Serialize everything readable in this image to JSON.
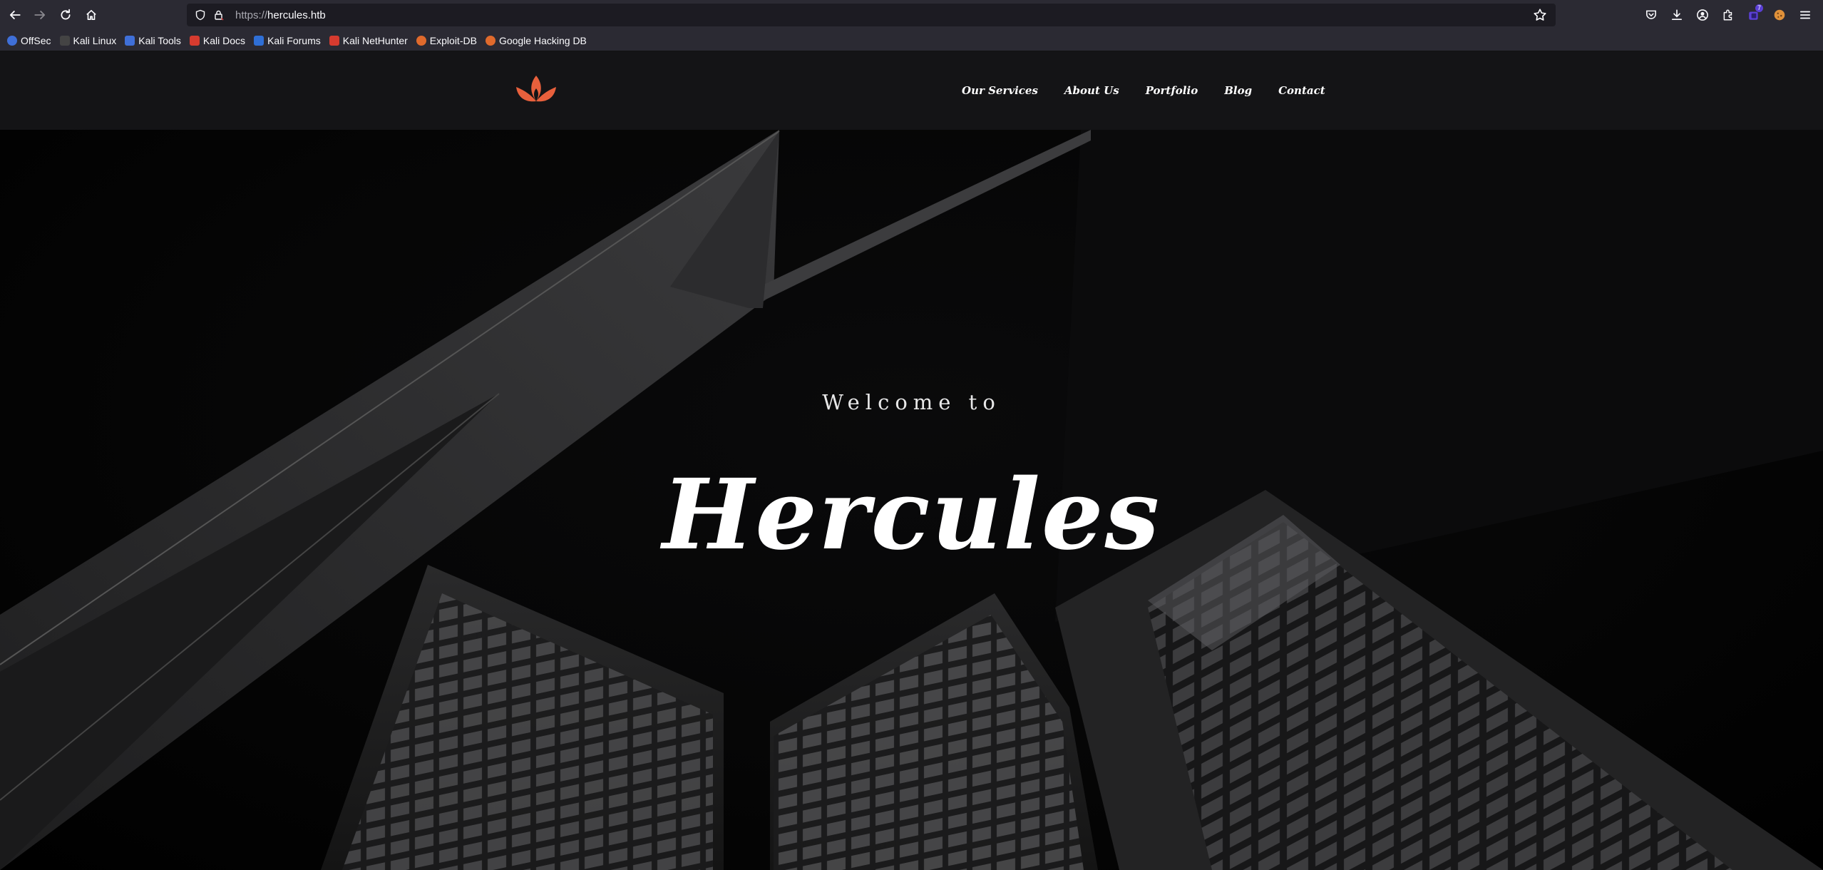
{
  "browser": {
    "url_scheme": "https://",
    "url_host": "hercules.htb",
    "extension_badge": "7"
  },
  "bookmarks": [
    {
      "label": "OffSec",
      "color": "#3f6fd8"
    },
    {
      "label": "Kali Linux",
      "color": "#2a2a2a"
    },
    {
      "label": "Kali Tools",
      "color": "#3f6fd8"
    },
    {
      "label": "Kali Docs",
      "color": "#d63b2f"
    },
    {
      "label": "Kali Forums",
      "color": "#2f6fd6"
    },
    {
      "label": "Kali NetHunter",
      "color": "#d63b2f"
    },
    {
      "label": "Exploit-DB",
      "color": "#e06a2c"
    },
    {
      "label": "Google Hacking DB",
      "color": "#e06a2c"
    }
  ],
  "site": {
    "logo_color": "#e8603c",
    "nav": [
      "Our Services",
      "About Us",
      "Portfolio",
      "Blog",
      "Contact"
    ],
    "hero": {
      "welcome": "Welcome to",
      "title": "Hercules"
    }
  }
}
